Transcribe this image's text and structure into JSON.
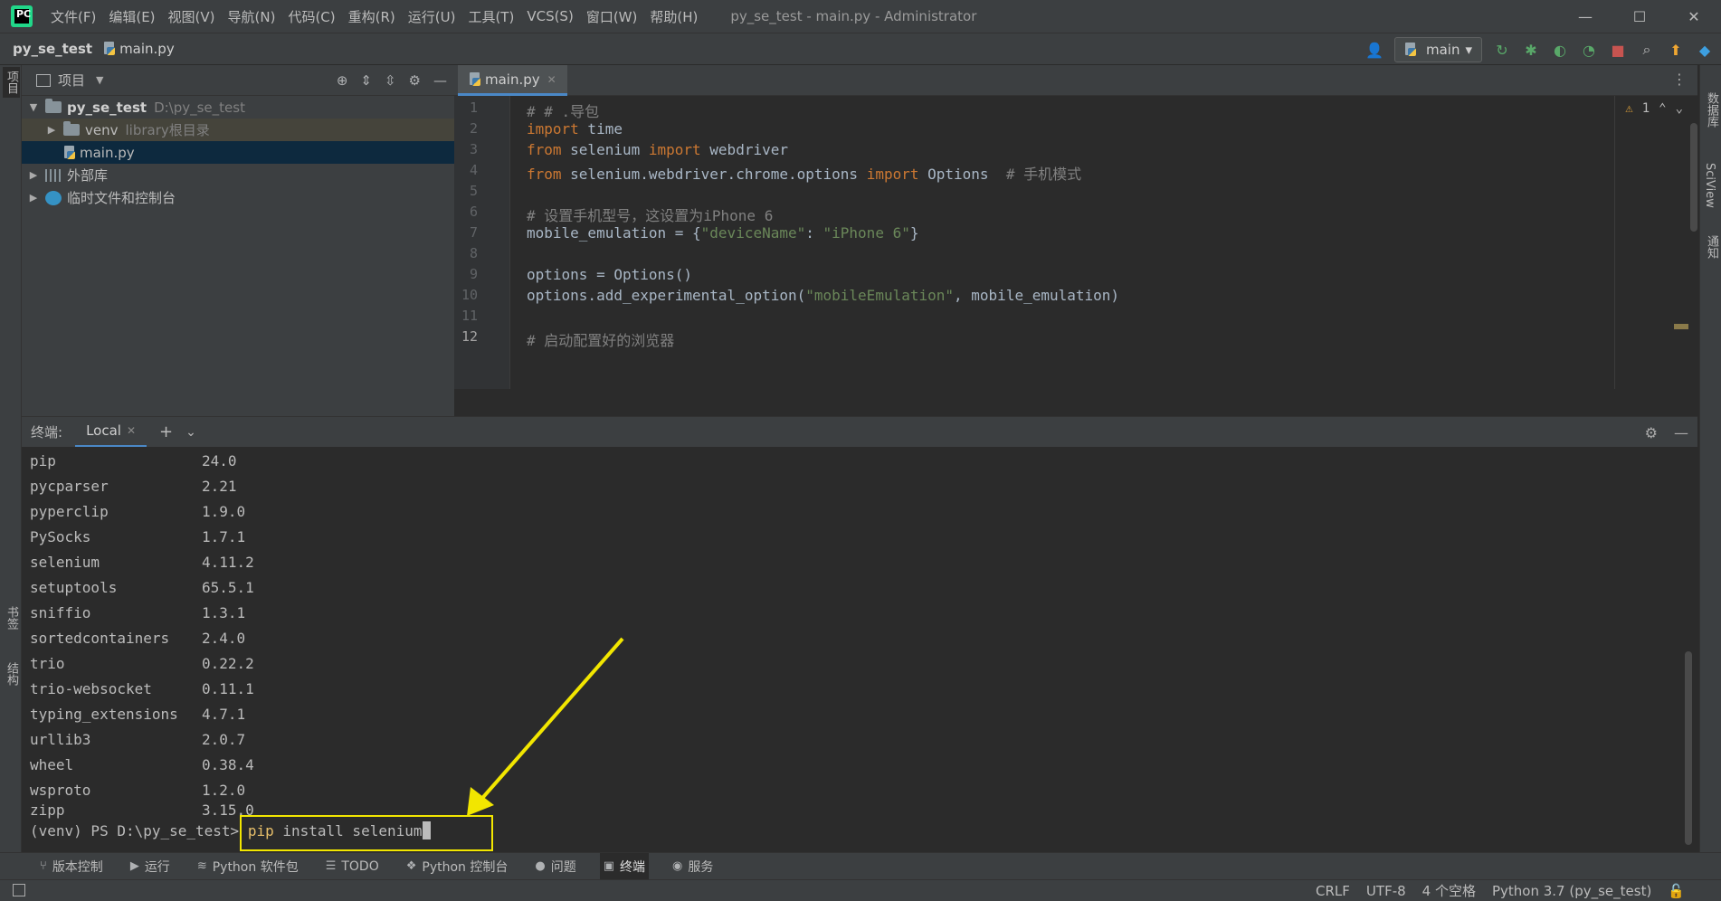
{
  "titlebar": {
    "menu": [
      "文件(F)",
      "编辑(E)",
      "视图(V)",
      "导航(N)",
      "代码(C)",
      "重构(R)",
      "运行(U)",
      "工具(T)",
      "VCS(S)",
      "窗口(W)",
      "帮助(H)"
    ],
    "window_title": "py_se_test - main.py - Administrator",
    "minimize": "—",
    "maximize": "☐",
    "close": "✕"
  },
  "navbar": {
    "project": "py_se_test",
    "file": "main.py",
    "run_config": "main"
  },
  "left_strip": {
    "project_tab": "项目",
    "bookmarks_tab": "书签",
    "structure_tab": "结构"
  },
  "right_strip": {
    "database_tab": "数据库",
    "sciview_tab": "SciView",
    "notifications_tab": "通知"
  },
  "project_panel": {
    "title": "项目",
    "tree": {
      "root_name": "py_se_test",
      "root_path": "D:\\py_se_test",
      "venv_name": "venv",
      "venv_note": "library根目录",
      "file_main": "main.py",
      "external_libs": "外部库",
      "scratches": "临时文件和控制台"
    }
  },
  "editor": {
    "tab": "main.py",
    "warning_count": "1",
    "line_numbers": [
      "1",
      "2",
      "3",
      "4",
      "5",
      "6",
      "7",
      "8",
      "9",
      "10",
      "11",
      "12"
    ],
    "current_line": 12
  },
  "terminal": {
    "label": "终端:",
    "tab": "Local",
    "packages": [
      {
        "name": "pip",
        "version": "24.0"
      },
      {
        "name": "pycparser",
        "version": "2.21"
      },
      {
        "name": "pyperclip",
        "version": "1.9.0"
      },
      {
        "name": "PySocks",
        "version": "1.7.1"
      },
      {
        "name": "selenium",
        "version": "4.11.2"
      },
      {
        "name": "setuptools",
        "version": "65.5.1"
      },
      {
        "name": "sniffio",
        "version": "1.3.1"
      },
      {
        "name": "sortedcontainers",
        "version": "2.4.0"
      },
      {
        "name": "trio",
        "version": "0.22.2"
      },
      {
        "name": "trio-websocket",
        "version": "0.11.1"
      },
      {
        "name": "typing_extensions",
        "version": "4.7.1"
      },
      {
        "name": "urllib3",
        "version": "2.0.7"
      },
      {
        "name": "wheel",
        "version": "0.38.4"
      },
      {
        "name": "wsproto",
        "version": "1.2.0"
      },
      {
        "name": "zipp",
        "version": "3.15.0"
      }
    ],
    "prompt": "(venv) PS D:\\py_se_test>",
    "command": "pip",
    "args": " install selenium"
  },
  "toolwindows": {
    "vcs": "版本控制",
    "run": "运行",
    "python_packages": "Python 软件包",
    "todo": "TODO",
    "python_console": "Python 控制台",
    "problems": "问题",
    "terminal": "终端",
    "services": "服务"
  },
  "statusbar": {
    "line_sep": "CRLF",
    "encoding": "UTF-8",
    "indent": "4 个空格",
    "interpreter": "Python 3.7 (py_se_test)"
  },
  "colors": {
    "annotation": "#f2e600",
    "accent": "#4a88c7"
  }
}
